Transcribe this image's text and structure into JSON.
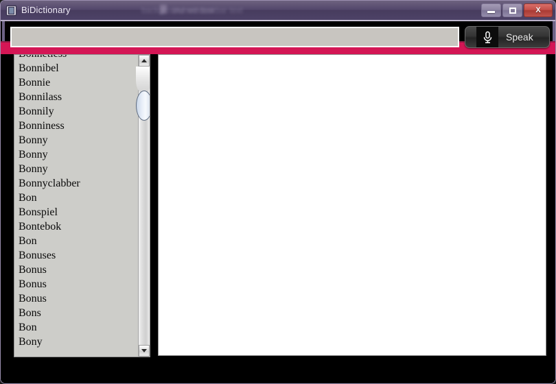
{
  "window": {
    "title": "BiDictionary",
    "icon": "book-icon",
    "controls": {
      "minimize_label": "Minimize",
      "maximize_label": "Maximize",
      "close_label": "X"
    },
    "ghost_text_left": "background window",
    "ghost_text_right": "blurred taskbar text"
  },
  "toolbar": {
    "search_value": "",
    "search_placeholder": "",
    "speak_label": "Speak",
    "mic_icon": "microphone-icon"
  },
  "colors": {
    "accent_pink": "#d41655",
    "titlebar_purple": "#51456a",
    "list_background": "#cdcdc9",
    "panel_background": "#ffffff",
    "speak_button": "#343434"
  },
  "word_list": {
    "items": [
      "Bonnetless",
      "Bonnibel",
      "Bonnie",
      "Bonnilass",
      "Bonnily",
      "Bonniness",
      "Bonny",
      "Bonny",
      "Bonny",
      "Bonnyclabber",
      "Bon",
      "Bonspiel",
      "Bontebok",
      "Bon",
      "Bonuses",
      "Bonus",
      "Bonus",
      "Bonus",
      "Bons",
      "Bon",
      "Bony"
    ],
    "scroll_up_icon": "triangle-up-icon",
    "scroll_down_icon": "triangle-down-icon"
  },
  "definition_panel": {
    "content": ""
  }
}
